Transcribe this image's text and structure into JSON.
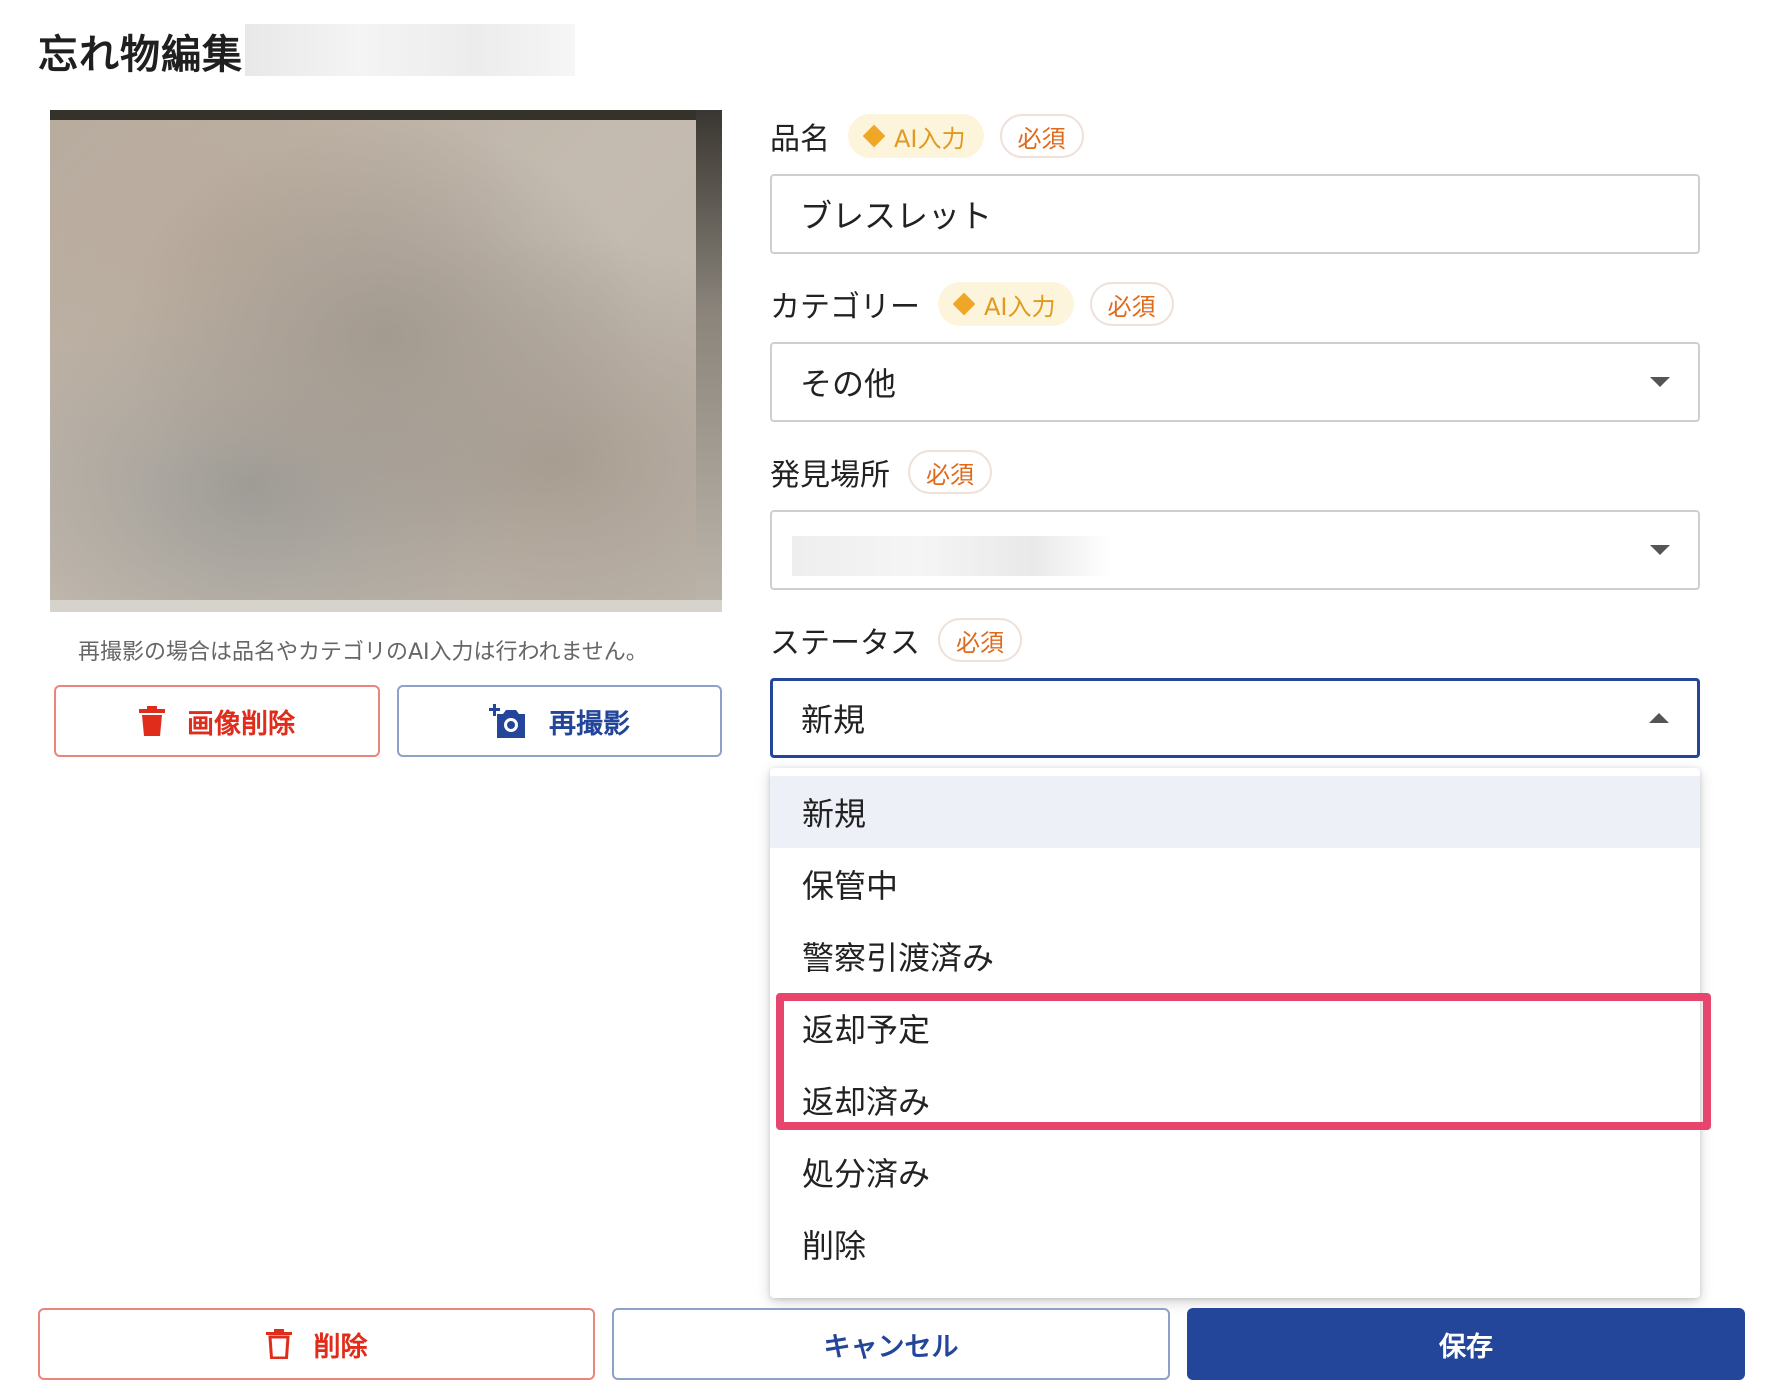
{
  "page": {
    "title": "忘れ物編集"
  },
  "image_panel": {
    "note": "再撮影の場合は品名やカテゴリのAI入力は行われません。",
    "delete_image_label": "画像削除",
    "retake_label": "再撮影"
  },
  "form": {
    "item_name": {
      "label": "品名",
      "ai_badge": "AI入力",
      "required_badge": "必須",
      "value": "ブレスレット"
    },
    "category": {
      "label": "カテゴリー",
      "ai_badge": "AI入力",
      "required_badge": "必須",
      "value": "その他"
    },
    "found_location": {
      "label": "発見場所",
      "required_badge": "必須",
      "value": ""
    },
    "status": {
      "label": "ステータス",
      "required_badge": "必須",
      "value": "新規",
      "options": [
        "新規",
        "保管中",
        "警察引渡済み",
        "返却予定",
        "返却済み",
        "処分済み",
        "削除"
      ],
      "selected_index": 0,
      "highlighted_options": [
        "返却予定",
        "返却済み"
      ]
    }
  },
  "footer": {
    "delete_label": "削除",
    "cancel_label": "キャンセル",
    "save_label": "保存"
  },
  "colors": {
    "primary": "#24469a",
    "danger": "#e02d1b",
    "ai_badge": "#e09a1f",
    "required_badge": "#e06a1a",
    "highlight": "#e8456e"
  }
}
